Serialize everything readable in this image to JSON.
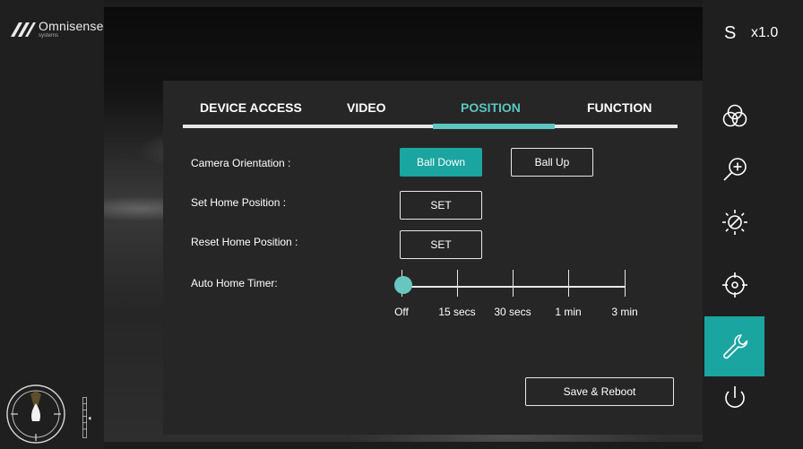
{
  "header": {
    "logo": {
      "name": "Omnisense",
      "sub": "systems"
    },
    "mode_label": "S",
    "zoom_label": "x1.0"
  },
  "tabs": [
    {
      "label": "DEVICE ACCESS",
      "active": false
    },
    {
      "label": "VIDEO",
      "active": false
    },
    {
      "label": "POSITION",
      "active": true
    },
    {
      "label": "FUNCTION",
      "active": false
    }
  ],
  "position": {
    "camera_orientation": {
      "label": "Camera Orientation :",
      "options": [
        "Ball Down",
        "Ball Up"
      ],
      "selected": "Ball Down"
    },
    "set_home": {
      "label": "Set Home Position :",
      "button": "SET"
    },
    "reset_home": {
      "label": "Reset Home Position :",
      "button": "SET"
    },
    "auto_home_timer": {
      "label": "Auto Home Timer:",
      "options": [
        "Off",
        "15 secs",
        "30 secs",
        "1 min",
        "3 min"
      ],
      "selected": "Off"
    },
    "save_button": "Save & Reboot"
  },
  "sidebar": [
    {
      "icon": "color-filter-icon",
      "active": false
    },
    {
      "icon": "zoom-in-icon",
      "active": false
    },
    {
      "icon": "brightness-icon",
      "active": false
    },
    {
      "icon": "target-icon",
      "active": false
    },
    {
      "icon": "wrench-icon",
      "active": true
    },
    {
      "icon": "power-icon",
      "active": false
    }
  ],
  "colors": {
    "accent": "#1aa5a0",
    "accent_light": "#5cc6c0",
    "panel": "#262626"
  }
}
